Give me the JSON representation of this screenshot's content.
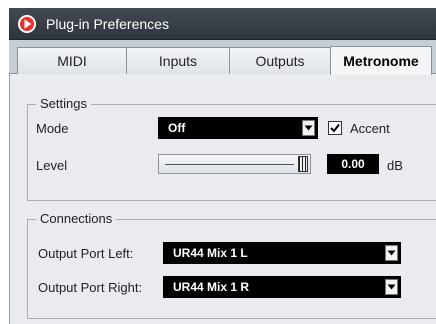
{
  "window": {
    "title": "Plug-in Preferences"
  },
  "tabs": [
    {
      "label": "MIDI"
    },
    {
      "label": "Inputs"
    },
    {
      "label": "Outputs"
    },
    {
      "label": "Metronome",
      "active": true
    }
  ],
  "settings": {
    "legend": "Settings",
    "mode_label": "Mode",
    "mode_value": "Off",
    "accent_label": "Accent",
    "accent_checked": true,
    "level_label": "Level",
    "level_value": "0.00",
    "level_unit": "dB",
    "level_fraction": 1.0
  },
  "connections": {
    "legend": "Connections",
    "left_label": "Output Port Left:",
    "left_value": "UR44 Mix 1 L",
    "right_label": "Output Port Right:",
    "right_value": "UR44 Mix 1 R"
  },
  "colors": {
    "titlebar": "#3a4048",
    "tab_strip": "#c7cdd4",
    "panel": "#e9ebee",
    "field_bg": "#000000",
    "field_text": "#ffffff"
  }
}
